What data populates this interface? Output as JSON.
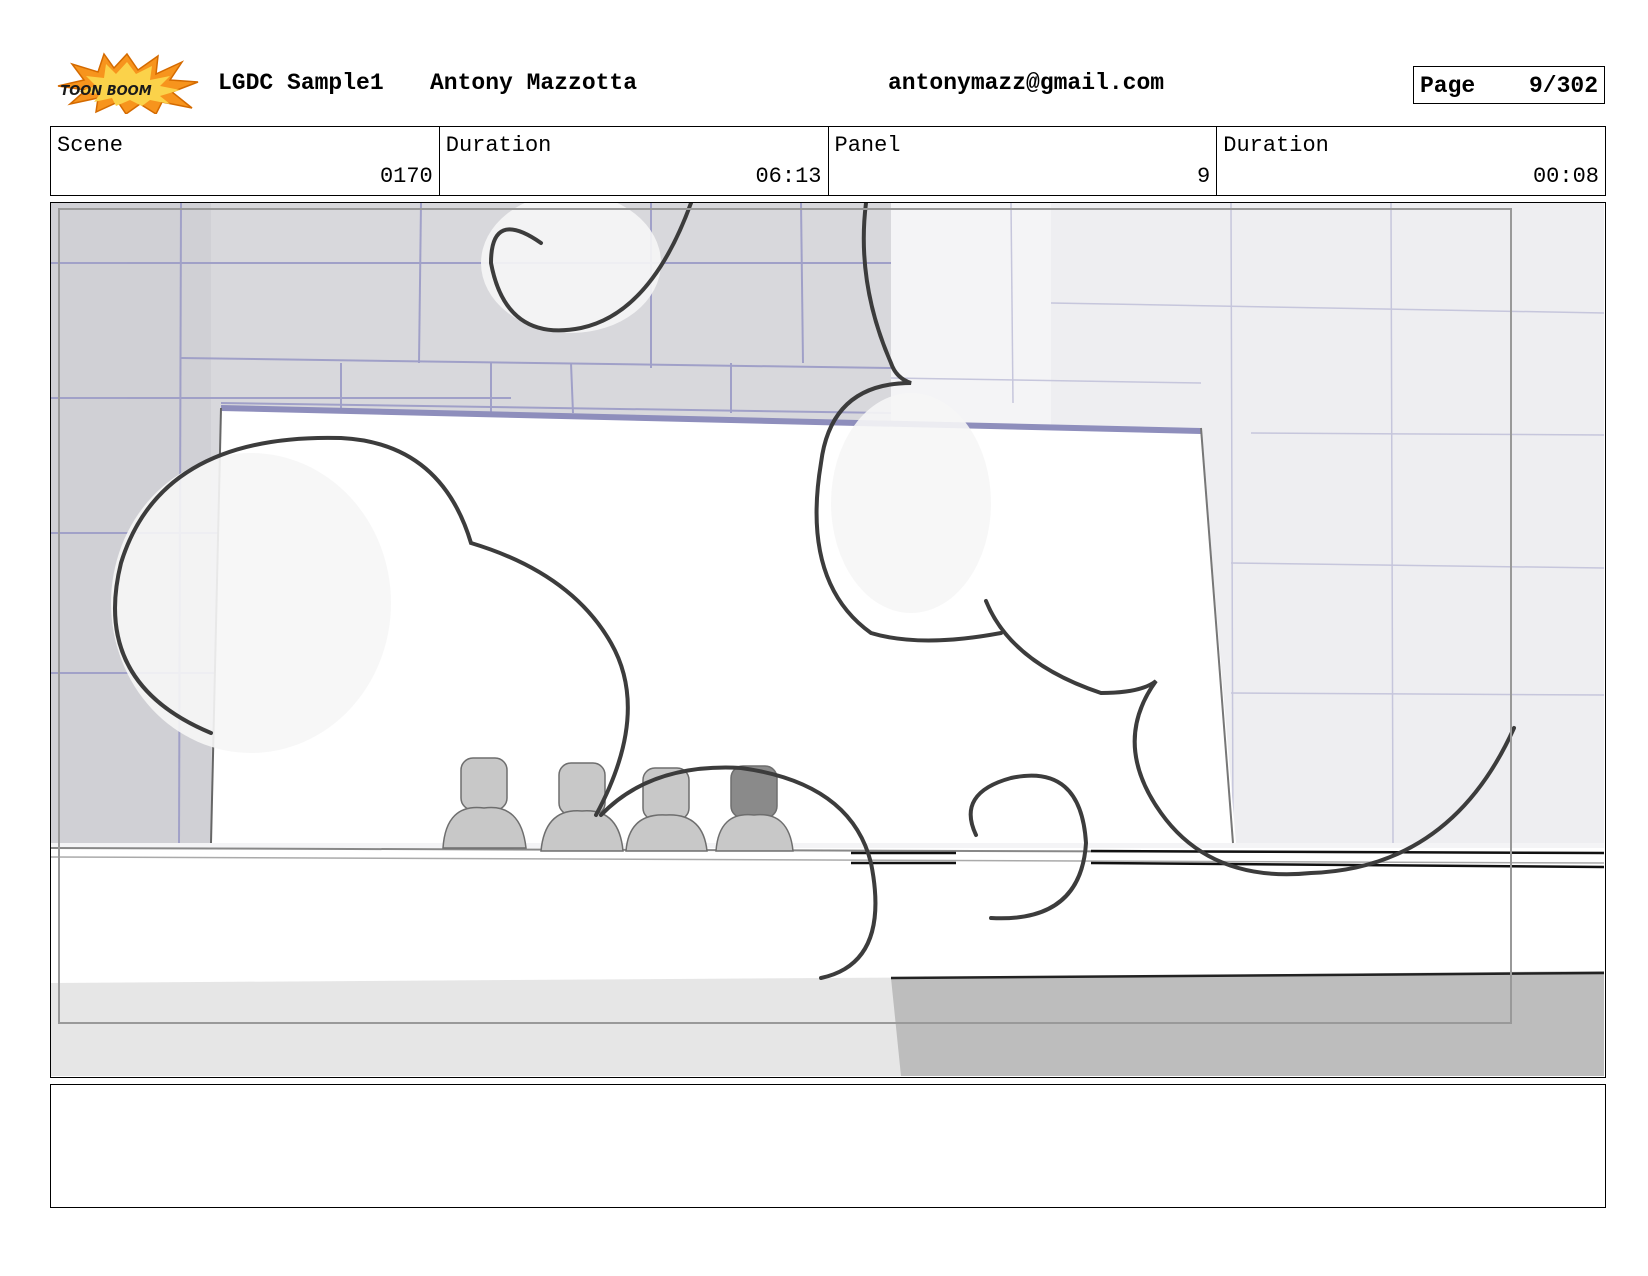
{
  "header": {
    "logo_text": "TOON BOOM",
    "project": "LGDC Sample1",
    "author": "Antony Mazzotta",
    "email": "antonymazz@gmail.com",
    "page_label": "Page",
    "page_number": "9/302"
  },
  "info": {
    "scene_label": "Scene",
    "scene_value": "0170",
    "scene_duration_label": "Duration",
    "scene_duration_value": "06:13",
    "panel_label": "Panel",
    "panel_value": "9",
    "panel_duration_label": "Duration",
    "panel_duration_value": "00:08"
  },
  "notes": {
    "text": ""
  },
  "colors": {
    "logo_orange": "#f7941d",
    "logo_dark": "#1a1a1a",
    "wall_gray": "#d6d6d9",
    "wall_light": "#efeff1",
    "tile_line": "#9b9bc6",
    "smoke_line": "#3c3c3c"
  }
}
